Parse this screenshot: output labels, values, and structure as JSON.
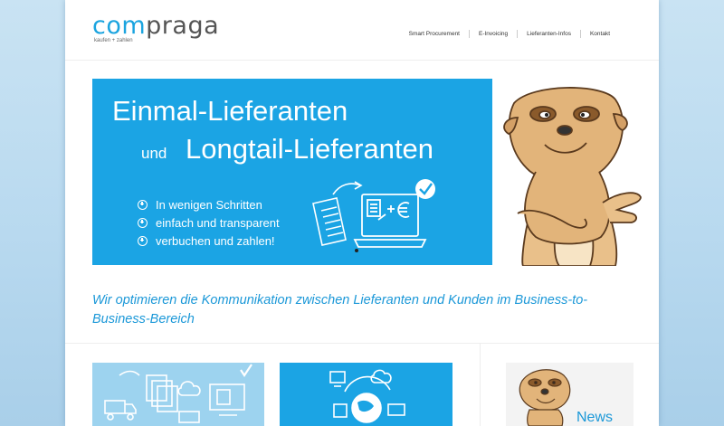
{
  "header": {
    "logo_com": "com",
    "logo_praga": "praga",
    "logo_tagline": "kaufen + zahlen",
    "nav": [
      "Smart Procurement",
      "E-Invoicing",
      "Lieferanten-Infos",
      "Kontakt"
    ]
  },
  "banner": {
    "headline_1": "Einmal-Lieferanten",
    "headline_und": "und",
    "headline_2": "Longtail-Lieferanten",
    "bullets": [
      "In wenigen Schritten",
      "einfach und transparent",
      "verbuchen und zahlen!"
    ]
  },
  "main": {
    "tagline": "Wir optimieren die Kommunikation zwischen Lieferanten und Kunden im Business-to-Business-Bereich"
  },
  "news": {
    "label": "News"
  },
  "colors": {
    "brand_blue": "#1ba4e4",
    "light_blue": "#9dd3ef",
    "text_blue": "#1b98d8"
  },
  "icons": [
    "meerkat-mascot",
    "document-icon",
    "laptop-icon",
    "checkmark-icon",
    "truck-icon",
    "cloud-icon",
    "globe-icon",
    "monitor-icon"
  ]
}
